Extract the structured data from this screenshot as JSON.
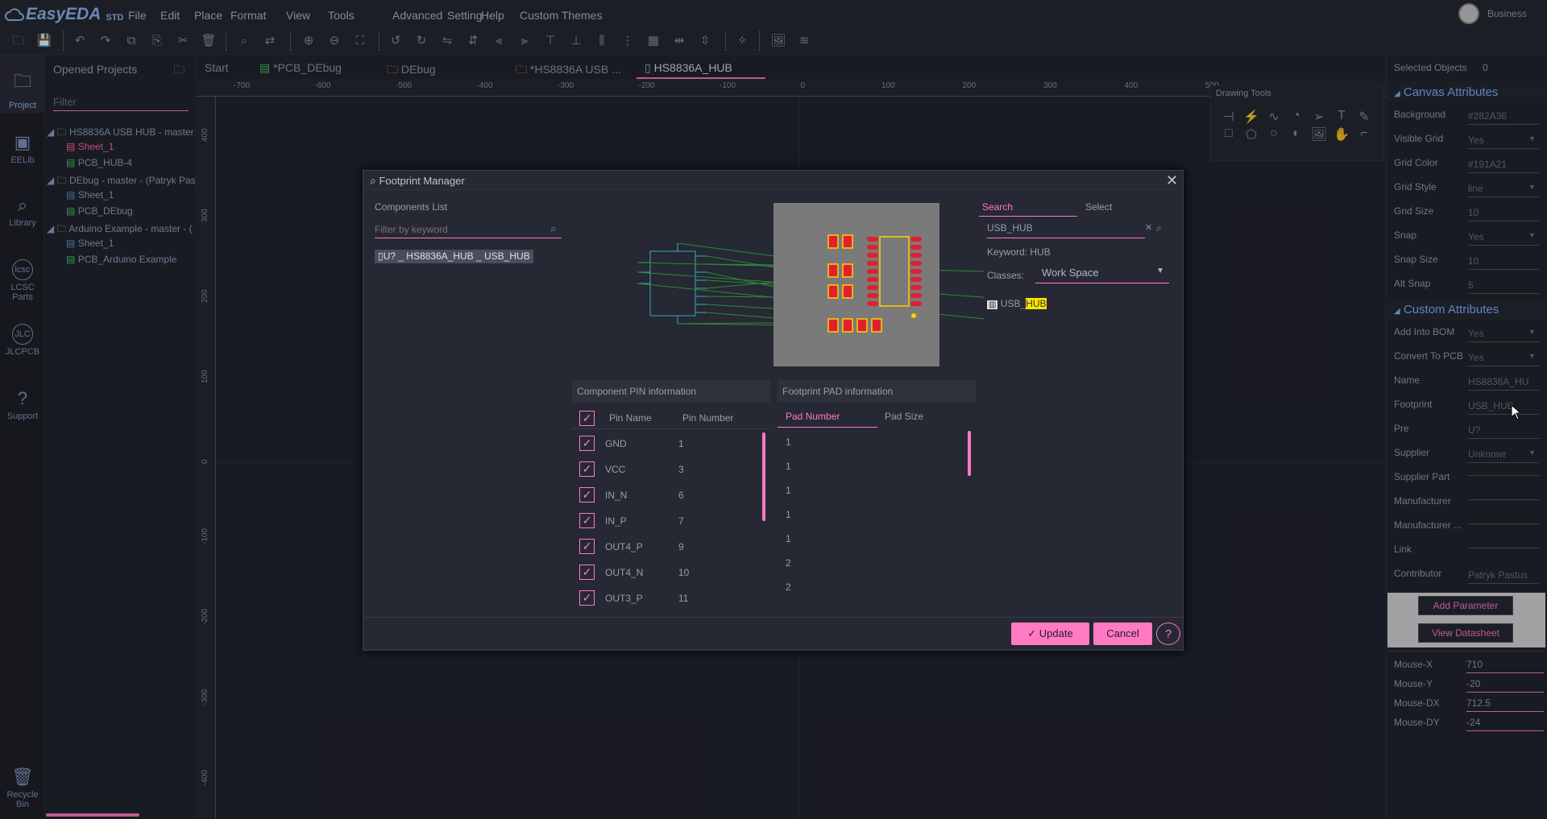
{
  "app": {
    "logo": "EasyEDA",
    "edition": "STD",
    "user": "Business"
  },
  "menu": [
    "File",
    "Edit",
    "Place",
    "Format",
    "View",
    "Tools",
    "Advanced",
    "Setting",
    "Help",
    "Custom Themes"
  ],
  "toolbar_icons": [
    "open-icon",
    "save-icon",
    "undo-icon",
    "redo-icon",
    "copy-icon",
    "paste-icon",
    "cut-icon",
    "delete-icon",
    "search-icon",
    "find-replace-icon",
    "zoom-in-icon",
    "zoom-out-icon",
    "fit-icon",
    "rotate-left-icon",
    "rotate-right-icon",
    "flip-h-icon",
    "flip-v-icon",
    "align-left-icon",
    "align-right-icon",
    "align-top-icon",
    "align-bottom-icon",
    "align-center-icon",
    "distribute-icon",
    "grid-align-icon",
    "dist-h-icon",
    "dist-v-icon",
    "sim-icon",
    "export-image-icon",
    "layers-icon"
  ],
  "leftbar": [
    {
      "label": "Project"
    },
    {
      "label": "EELib"
    },
    {
      "label": "Library"
    },
    {
      "label": "LCSC Parts"
    },
    {
      "label": "JLCPCB"
    },
    {
      "label": "Support"
    },
    {
      "label": "Recycle Bin"
    }
  ],
  "projects": {
    "title": "Opened Projects",
    "filter_placeholder": "Filter",
    "tree": [
      {
        "label": "HS8836A USB HUB - master",
        "children": [
          "Sheet_1",
          "PCB_HUB-4"
        ]
      },
      {
        "label": "DEbug - master - (Patryk Pas",
        "children": [
          "Sheet_1",
          "PCB_DEbug"
        ]
      },
      {
        "label": "Arduino Example - master - (",
        "children": [
          "Sheet_1",
          "PCB_Arduino Example"
        ]
      }
    ]
  },
  "tabs": [
    "Start",
    "*PCB_DEbug",
    "DEbug",
    "*HS8836A USB ...",
    "HS8836A_HUB"
  ],
  "ruler_top": [
    "-700",
    "-600",
    "-500",
    "-400",
    "-300",
    "-200",
    "-100",
    "0",
    "100",
    "200",
    "300",
    "400",
    "500"
  ],
  "ruler_left": [
    "400",
    "300",
    "200",
    "100",
    "0",
    "-100",
    "-200",
    "-300",
    "-400"
  ],
  "drawing_tools": {
    "title": "Drawing Tools"
  },
  "right_panel": {
    "selected_label": "Selected Objects",
    "selected_count": "0",
    "canvas_head": "Canvas Attributes",
    "canvas": [
      {
        "label": "Background",
        "value": "#282A36"
      },
      {
        "label": "Visible Grid",
        "value": "Yes"
      },
      {
        "label": "Grid Color",
        "value": "#191A21"
      },
      {
        "label": "Grid Style",
        "value": "line"
      },
      {
        "label": "Grid Size",
        "value": "10"
      },
      {
        "label": "Snap",
        "value": "Yes"
      },
      {
        "label": "Snap Size",
        "value": "10"
      },
      {
        "label": "Alt Snap",
        "value": "5"
      }
    ],
    "custom_head": "Custom Attributes",
    "custom": [
      {
        "label": "Add Into BOM",
        "value": "Yes"
      },
      {
        "label": "Convert To PCB",
        "value": "Yes"
      },
      {
        "label": "Name",
        "value": "HS8836A_HU"
      },
      {
        "label": "Footprint",
        "value": "USB_HUB"
      },
      {
        "label": "Pre",
        "value": "U?"
      },
      {
        "label": "Supplier",
        "value": "Unknowr"
      },
      {
        "label": "Supplier Part",
        "value": ""
      },
      {
        "label": "Manufacturer",
        "value": ""
      },
      {
        "label": "Manufacturer ...",
        "value": ""
      },
      {
        "label": "Link",
        "value": ""
      },
      {
        "label": "Contributor",
        "value": "Patryk Pastus"
      }
    ],
    "add_param": "Add Parameter",
    "view_datasheet": "View Datasheet",
    "mouse": [
      {
        "label": "Mouse-X",
        "value": "710"
      },
      {
        "label": "Mouse-Y",
        "value": "-20"
      },
      {
        "label": "Mouse-DX",
        "value": "712.5"
      },
      {
        "label": "Mouse-DY",
        "value": "-24"
      }
    ]
  },
  "dialog": {
    "title": "Footprint Manager",
    "components_list": "Components List",
    "filter_placeholder": "Filter by keyword",
    "component": "U? _ HS8836A_HUB _ USB_HUB",
    "search_tab": "Search",
    "select_tab": "Select",
    "search_value": "USB_HUB",
    "keyword": "Keyword: HUB",
    "classes_label": "Classes:",
    "classes_value": "Work Space",
    "result_prefix": "USB_",
    "result_highlight": "HUB",
    "pin_head": "Component PIN information",
    "pin_col_name": "Pin Name",
    "pin_col_number": "Pin Number",
    "pins": [
      {
        "name": "GND",
        "number": "1"
      },
      {
        "name": "VCC",
        "number": "3"
      },
      {
        "name": "IN_N",
        "number": "6"
      },
      {
        "name": "IN_P",
        "number": "7"
      },
      {
        "name": "OUT4_P",
        "number": "9"
      },
      {
        "name": "OUT4_N",
        "number": "10"
      },
      {
        "name": "OUT3_P",
        "number": "11"
      }
    ],
    "pad_head": "Footprint PAD information",
    "pad_col_number": "Pad Number",
    "pad_col_size": "Pad Size",
    "pads": [
      "1",
      "1",
      "1",
      "1",
      "1",
      "2",
      "2"
    ],
    "update": "Update",
    "cancel": "Cancel",
    "colors": {
      "accent": "#ff79c6",
      "pad": "#e02030",
      "outline": "#ffd000"
    }
  }
}
